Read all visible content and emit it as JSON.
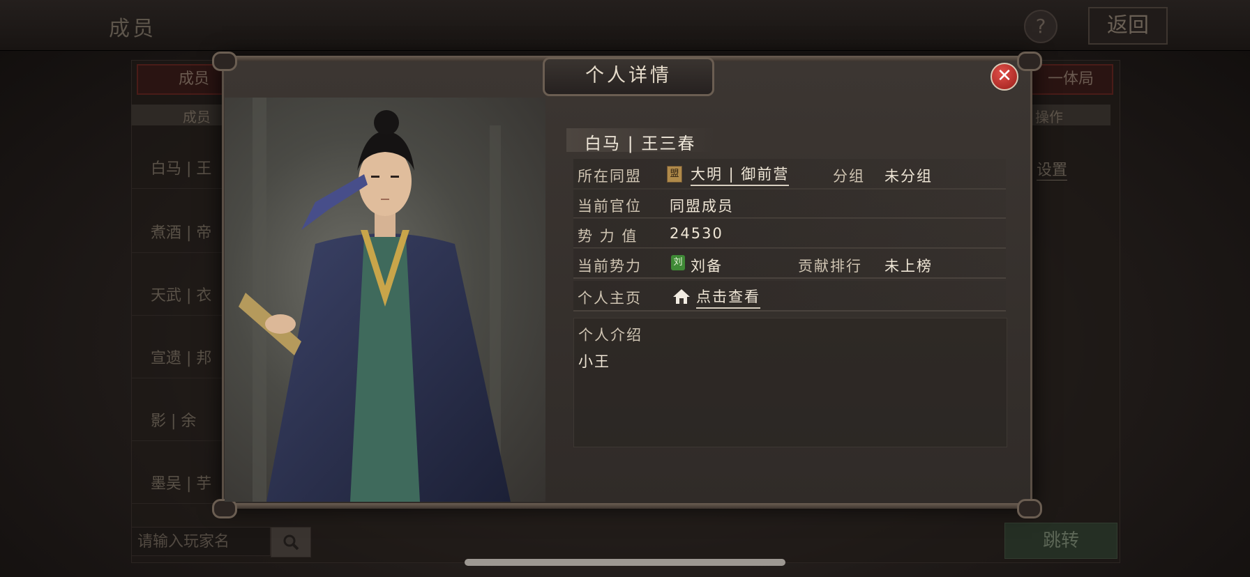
{
  "background": {
    "page_title": "成员",
    "help_label": "?",
    "back_label": "返回",
    "tab_members": "成员",
    "tab_right": "一体局",
    "col_member": "成员",
    "col_operation": "操作",
    "rows": [
      "白马 | 王",
      "煮酒 | 帝",
      "天武 | 衣",
      "宣遗 | 邦",
      "影 | 余",
      "墨吴 | 芋"
    ],
    "settings_link": "设置",
    "search_placeholder": "请输入玩家名",
    "jump_label": "跳转"
  },
  "modal": {
    "title": "个人详情",
    "close_label": "✕",
    "player_name": "白马 | 王三春",
    "alliance_label": "所在同盟",
    "alliance_badge": "盟",
    "alliance_value": "大明 | 御前营",
    "group_label": "分组",
    "group_value": "未分组",
    "position_label": "当前官位",
    "position_value": "同盟成员",
    "power_label": "势 力 值",
    "power_value": "24530",
    "faction_label": "当前势力",
    "faction_badge": "刘",
    "faction_value": "刘备",
    "rank_label": "贡献排行",
    "rank_value": "未上榜",
    "homepage_label": "个人主页",
    "homepage_link": "点击查看",
    "intro_label": "个人介绍",
    "intro_text": "小王"
  },
  "colors": {
    "close_red": "#c8302a",
    "faction_green": "#3f8a36",
    "alliance_badge": "#b08a4a"
  }
}
